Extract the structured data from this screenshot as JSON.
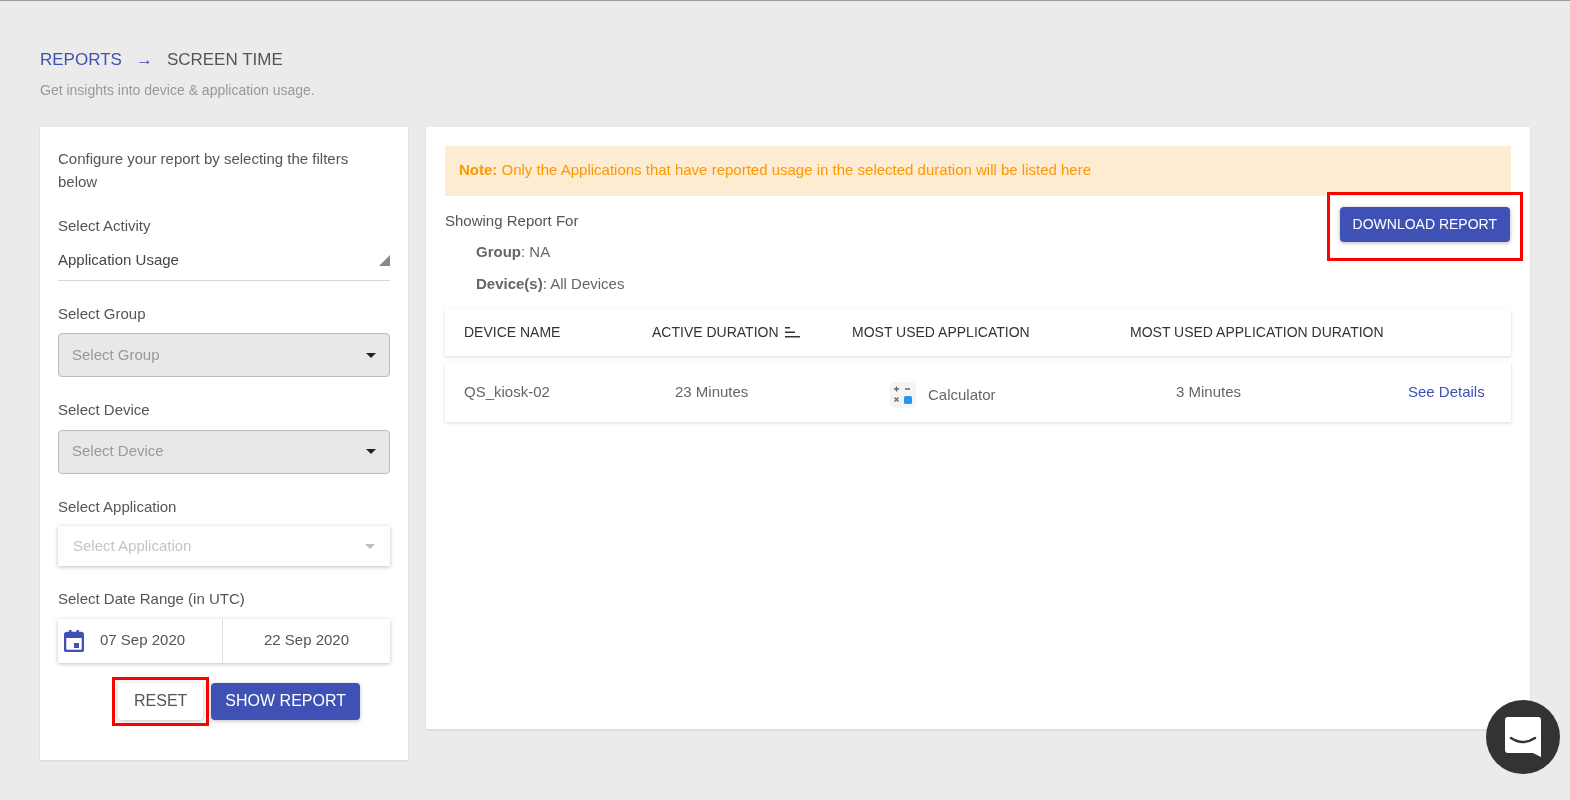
{
  "breadcrumb": {
    "parent": "REPORTS",
    "separator": "→",
    "current": "SCREEN TIME"
  },
  "subtitle": "Get insights into device & application usage.",
  "filters": {
    "intro": "Configure your report by selecting the filters below",
    "fields": [
      {
        "label": "Select Activity",
        "kind": "underline",
        "value": "Application Usage"
      },
      {
        "label": "Select Group",
        "kind": "disabled",
        "placeholder": "Select Group"
      },
      {
        "label": "Select Device",
        "kind": "disabled",
        "placeholder": "Select Device"
      },
      {
        "label": "Select Application",
        "kind": "outlined",
        "placeholder": "Select Application"
      }
    ],
    "date_range": {
      "label": "Select Date Range (in UTC)",
      "start": "07 Sep 2020",
      "end": "22 Sep 2020"
    },
    "buttons": [
      {
        "label": "RESET",
        "kind": "secondary",
        "highlighted": true
      },
      {
        "label": "SHOW REPORT",
        "kind": "primary",
        "highlighted": false
      }
    ]
  },
  "report": {
    "note_label": "Note:",
    "note": "Only the Applications that have reported usage in the selected duration will be listed here",
    "showing_title": "Showing Report For",
    "details": [
      "**Group**: NA",
      "**Device(s)**: All Devices"
    ],
    "download": {
      "label": "DOWNLOAD REPORT",
      "highlighted": true
    },
    "table": {
      "columns": [
        {
          "label": "DEVICE NAME",
          "sortable": false
        },
        {
          "label": "ACTIVE DURATION",
          "sortable": true
        },
        {
          "label": "MOST USED APPLICATION",
          "sortable": false
        },
        {
          "label": "MOST USED APPLICATION DURATION",
          "sortable": false
        }
      ],
      "rows": [
        {
          "device": "QS_kiosk-02",
          "active": "23 Minutes",
          "app": "Calculator",
          "app_duration": "3 Minutes",
          "link": "See Details"
        }
      ]
    }
  }
}
